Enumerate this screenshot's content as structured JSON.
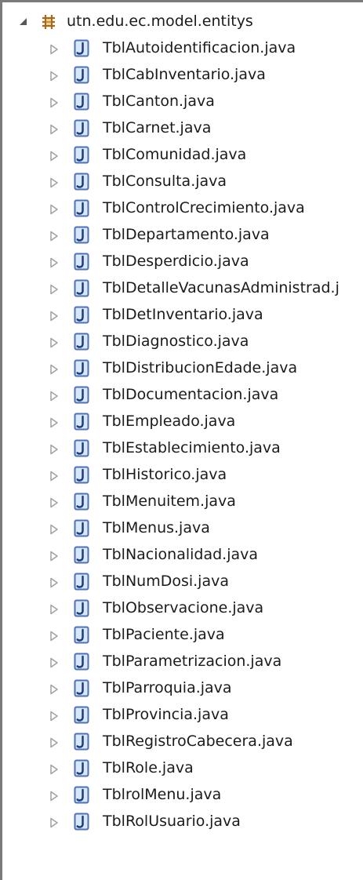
{
  "package": {
    "name": "utn.edu.ec.model.entitys",
    "expanded": true,
    "icon": "package-icon"
  },
  "files": [
    "TblAutoidentificacion.java",
    "TblCabInventario.java",
    "TblCanton.java",
    "TblCarnet.java",
    "TblComunidad.java",
    "TblConsulta.java",
    "TblControlCrecimiento.java",
    "TblDepartamento.java",
    "TblDesperdicio.java",
    "TblDetalleVacunasAdministrad.j",
    "TblDetInventario.java",
    "TblDiagnostico.java",
    "TblDistribucionEdade.java",
    "TblDocumentacion.java",
    "TblEmpleado.java",
    "TblEstablecimiento.java",
    "TblHistorico.java",
    "TblMenuitem.java",
    "TblMenus.java",
    "TblNacionalidad.java",
    "TblNumDosi.java",
    "TblObservacione.java",
    "TblPaciente.java",
    "TblParametrizacion.java",
    "TblParroquia.java",
    "TblProvincia.java",
    "TblRegistroCabecera.java",
    "TblRole.java",
    "TblrolMenu.java",
    "TblRolUsuario.java"
  ],
  "colors": {
    "package_icon": "#a46a1f",
    "java_icon_border": "#4f70b6",
    "java_icon_fill": "#d8e7fb",
    "java_icon_letter": "#1b3f7d",
    "expander": "#595959",
    "collapsed_expander": "#a0a0a0"
  }
}
